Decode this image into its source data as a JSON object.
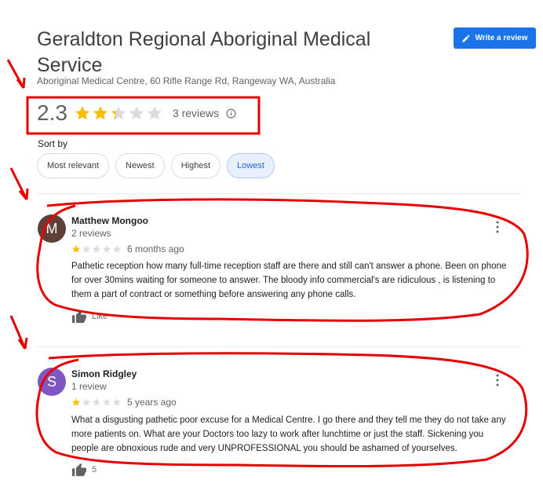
{
  "header": {
    "title": "Geraldton Regional Aboriginal Medical Service",
    "address": "Aboriginal Medical Centre, 60 Rifle Range Rd, Rangeway WA, Australia",
    "write_review_label": "Write a review"
  },
  "rating": {
    "value": "2.3",
    "stars_filled": 2.3,
    "reviews_label": "3 reviews"
  },
  "sort": {
    "label": "Sort by",
    "options": [
      "Most relevant",
      "Newest",
      "Highest",
      "Lowest"
    ],
    "selected": "Lowest"
  },
  "reviews": [
    {
      "initial": "M",
      "avatar_color": "#5d4037",
      "name": "Matthew Mongoo",
      "review_count": "2 reviews",
      "stars": 1,
      "date": "6 months ago",
      "text": "Pathetic reception how many full-time reception staff are there and still can't answer a phone.  Been on phone for over 30mins waiting for someone to answer.  The bloody info commercial's  are ridiculous , is listening to them a part of contract or something before answering any phone calls.",
      "like_label": "Like"
    },
    {
      "initial": "S",
      "avatar_color": "#7e57c2",
      "name": "Simon Ridgley",
      "review_count": "1 review",
      "stars": 1,
      "date": "5 years ago",
      "text": "What a disgusting pathetic poor excuse for a Medical Centre. I go there and they tell me they do not take any more patients on. What are your Doctors too lazy to work after lunchtime or just the staff. Sickening you people are obnoxious rude and very UNPROFESSIONAL you should be ashamed of yourselves.",
      "like_label": "5"
    }
  ],
  "colors": {
    "star_filled": "#fbbc04",
    "star_empty": "#dadce0",
    "accent": "#1a73e8",
    "annotation": "#e60000"
  }
}
